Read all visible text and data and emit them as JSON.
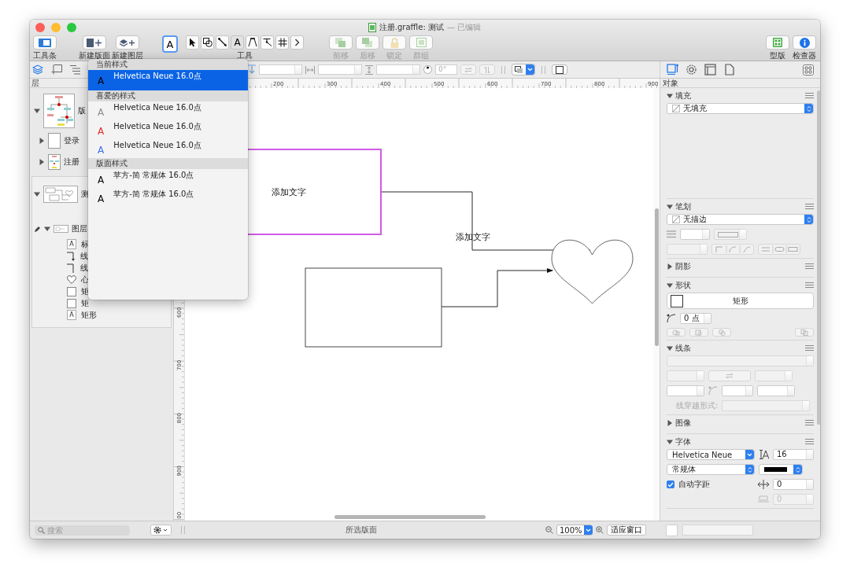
{
  "window": {
    "title": "注册.graffle: 测试",
    "status": "— 已编辑"
  },
  "toolbar": {
    "view": [
      {
        "label": "工具条"
      }
    ],
    "new": [
      {
        "label": "新建版面"
      },
      {
        "label": "新建图层"
      }
    ],
    "style": {
      "glyph": "A",
      "expanded": true
    },
    "tools": {
      "label": "工具",
      "items": [
        {
          "kind": "pointer"
        },
        {
          "kind": "shape"
        },
        {
          "kind": "line"
        },
        {
          "kind": "text",
          "glyph": "A"
        },
        {
          "kind": "pen"
        },
        {
          "kind": "bezier"
        },
        {
          "kind": "grid"
        },
        {
          "kind": "more"
        }
      ]
    },
    "arrange": [
      {
        "label": "前移",
        "disabled": true
      },
      {
        "label": "后移",
        "disabled": true
      },
      {
        "label": "锁定",
        "disabled": true
      },
      {
        "label": "群组",
        "disabled": true
      }
    ],
    "panels": [
      {
        "label": "型版"
      },
      {
        "label": "检查器"
      }
    ]
  },
  "sidebar": {
    "tabs": [
      {
        "selected": true
      },
      {
        "selected": false
      },
      {
        "selected": false
      }
    ],
    "title": "层",
    "items": [
      {
        "label": "版",
        "expanded": true,
        "selected": false,
        "children": [
          {
            "label": "登录",
            "expanded": false
          },
          {
            "label": "注册",
            "expanded": false
          }
        ]
      },
      {
        "label": "测",
        "expanded": true,
        "selected": true,
        "children": [
          {
            "label": "图层",
            "expanded": true,
            "children": [
              {
                "kind": "text",
                "glyph": "A",
                "label": "标"
              },
              {
                "kind": "arrow",
                "label": "线"
              },
              {
                "kind": "line",
                "label": "线"
              },
              {
                "kind": "heart",
                "label": "心"
              },
              {
                "kind": "shape",
                "label": "矩"
              },
              {
                "kind": "shape",
                "label": "矩"
              },
              {
                "kind": "text",
                "glyph": "A",
                "label": "矩形"
              }
            ]
          }
        ]
      }
    ]
  },
  "format_bar": {
    "rotation": "0°"
  },
  "ruler": {
    "x_labels": [
      "200",
      "300",
      "400",
      "500",
      "600",
      "700",
      "800",
      "900"
    ],
    "y_labels": [
      "600",
      "700",
      "800",
      "900",
      "00"
    ]
  },
  "canvas": {
    "shapes": [
      {
        "kind": "rect",
        "label": "添加文字",
        "selected": true
      },
      {
        "kind": "label",
        "label": "添加文字",
        "selected": false
      },
      {
        "kind": "rect",
        "selected": false
      },
      {
        "kind": "heart",
        "selected": false
      }
    ]
  },
  "style_menu": {
    "sections": [
      {
        "heading": "当前样式",
        "items": [
          {
            "glyph": "A",
            "label": "Helvetica Neue 16.0点",
            "color": "#000000",
            "selected": true
          }
        ]
      },
      {
        "heading": "喜爱的样式",
        "items": [
          {
            "glyph": "A",
            "label": "Helvetica Neue 16.0点",
            "color": "#8c8c8c",
            "selected": false
          },
          {
            "glyph": "A",
            "label": "Helvetica Neue 16.0点",
            "color": "#e5291f",
            "selected": false
          },
          {
            "glyph": "A",
            "label": "Helvetica Neue 16.0点",
            "color": "#3d6ef2",
            "selected": false
          }
        ]
      },
      {
        "heading": "版面样式",
        "items": [
          {
            "glyph": "A",
            "label": "苹方-简 常规体 16.0点",
            "color": "#000000",
            "selected": false
          },
          {
            "glyph": "A",
            "label": "苹方-简 常规体 16.0点",
            "color": "#000000",
            "selected": false
          }
        ]
      }
    ]
  },
  "inspector": {
    "tabs": [
      {
        "selected": true
      },
      {
        "selected": false
      },
      {
        "selected": false
      },
      {
        "selected": false
      }
    ],
    "title": "对象",
    "sections": [
      {
        "kind": "fill",
        "title": "填充",
        "expanded": true,
        "popup": "无填充"
      },
      {
        "kind": "stroke",
        "title": "笔划",
        "expanded": true,
        "popup": "无描边"
      },
      {
        "kind": "shadow",
        "title": "阴影",
        "expanded": false
      },
      {
        "kind": "shape",
        "title": "形状",
        "expanded": true,
        "shape": "矩形",
        "corner": "0 点"
      },
      {
        "kind": "line",
        "title": "线条",
        "expanded": true,
        "cross_label": "线穿越形式:"
      },
      {
        "kind": "image",
        "title": "图像",
        "expanded": false
      },
      {
        "kind": "font",
        "title": "字体",
        "expanded": true,
        "family": "Helvetica Neue",
        "size": "16",
        "weight": "常规体",
        "auto_kerning": {
          "label": "自动字距",
          "checked": true
        },
        "kerning": "0",
        "baseline": "0"
      }
    ]
  },
  "status_bar": {
    "search_placeholder": "搜索",
    "caption": "所选版面",
    "zoom": "100%",
    "fit": "适应窗口"
  }
}
